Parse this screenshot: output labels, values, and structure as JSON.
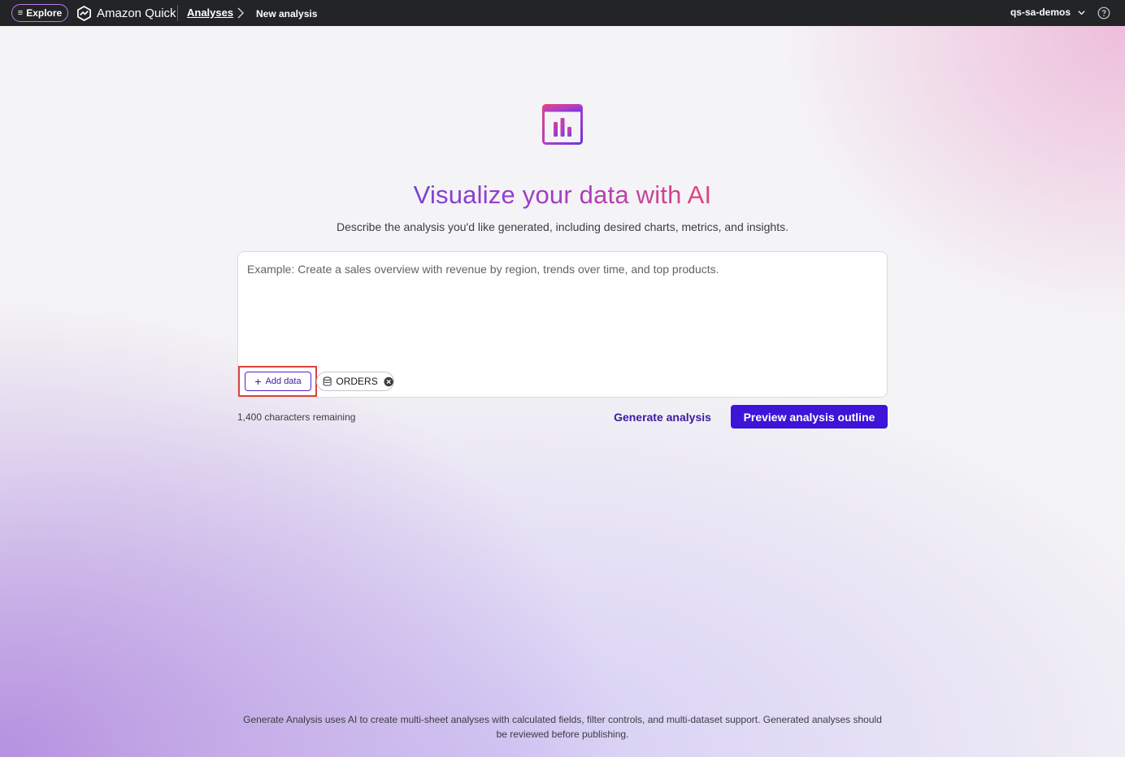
{
  "topbar": {
    "explore_label": "Explore",
    "brand_name": "Amazon Quick",
    "breadcrumb_parent": "Analyses",
    "breadcrumb_current": "New analysis",
    "account_name": "qs-sa-demos"
  },
  "hero": {
    "title": "Visualize your data with AI",
    "subtitle": "Describe the analysis you'd like generated, including desired charts, metrics, and insights."
  },
  "prompt": {
    "placeholder": "Example: Create a sales overview with revenue by region, trends over time, and top products.",
    "value": "",
    "add_data_label": "Add data",
    "datasets": [
      "ORDERS"
    ]
  },
  "footer": {
    "chars_remaining": "1,400 characters remaining",
    "generate_label": "Generate analysis",
    "preview_label": "Preview analysis outline",
    "disclaimer": "Generate Analysis uses AI to create multi-sheet analyses with calculated fields, filter controls, and multi-dataset support. Generated analyses should be reviewed before publishing."
  },
  "colors": {
    "topbar_bg": "#232426",
    "primary_button": "#3d14d8",
    "link_text": "#3a1c9e",
    "highlight_border": "#d9443a",
    "title_gradient_start": "#7b3fd6",
    "title_gradient_end": "#e0457e"
  },
  "icons": [
    "menu-icon",
    "amazon-quick-logo-icon",
    "chevron-right-icon",
    "chevron-down-icon",
    "help-icon",
    "chart-window-icon",
    "plus-icon",
    "database-icon",
    "close-circle-icon"
  ]
}
